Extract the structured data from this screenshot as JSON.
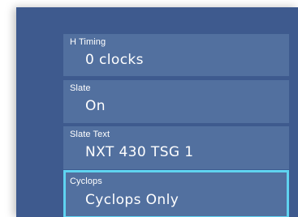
{
  "settings": {
    "items": [
      {
        "label": "H Timing",
        "value": "0 clocks",
        "selected": false
      },
      {
        "label": "Slate",
        "value": "On",
        "selected": false
      },
      {
        "label": "Slate Text",
        "value": "NXT 430 TSG 1",
        "selected": false
      },
      {
        "label": "Cyclops",
        "value": "Cyclops Only",
        "selected": true
      }
    ]
  },
  "colors": {
    "panel_background": "#3e5a8e",
    "item_background": "#52709f",
    "selection_border": "#5fd3f0",
    "text": "#ffffff"
  }
}
